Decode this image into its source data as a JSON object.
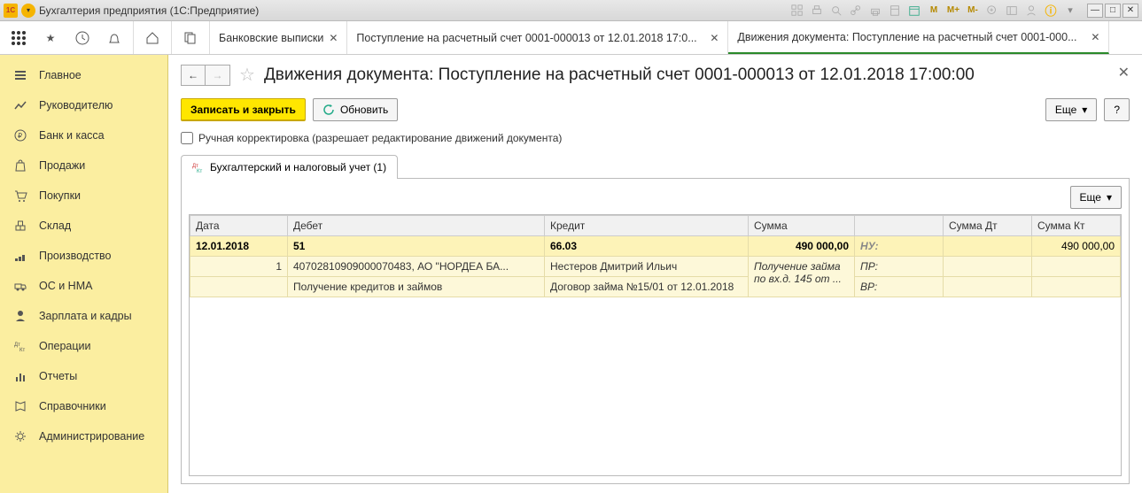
{
  "titlebar": {
    "logo_text": "1C",
    "title": "Бухгалтерия предприятия  (1С:Предприятие)",
    "m_labels": [
      "M",
      "M+",
      "M-"
    ]
  },
  "tabs": [
    {
      "label": "Банковские выписки",
      "closable": true,
      "active": false
    },
    {
      "label": "Поступление на расчетный счет 0001-000013 от 12.01.2018 17:0...",
      "closable": true,
      "active": false
    },
    {
      "label": "Движения документа: Поступление на расчетный счет 0001-000...",
      "closable": true,
      "active": true
    }
  ],
  "sidebar": {
    "items": [
      {
        "label": "Главное",
        "icon": "menu"
      },
      {
        "label": "Руководителю",
        "icon": "chart"
      },
      {
        "label": "Банк и касса",
        "icon": "ruble"
      },
      {
        "label": "Продажи",
        "icon": "bag"
      },
      {
        "label": "Покупки",
        "icon": "cart"
      },
      {
        "label": "Склад",
        "icon": "boxes"
      },
      {
        "label": "Производство",
        "icon": "factory"
      },
      {
        "label": "ОС и НМА",
        "icon": "truck"
      },
      {
        "label": "Зарплата и кадры",
        "icon": "person"
      },
      {
        "label": "Операции",
        "icon": "dtkt"
      },
      {
        "label": "Отчеты",
        "icon": "barchart"
      },
      {
        "label": "Справочники",
        "icon": "book"
      },
      {
        "label": "Администрирование",
        "icon": "gear"
      }
    ]
  },
  "page": {
    "title": "Движения документа: Поступление на расчетный счет 0001-000013 от 12.01.2018 17:00:00",
    "save_close": "Записать и закрыть",
    "refresh": "Обновить",
    "more": "Еще",
    "help": "?",
    "manual_edit": "Ручная корректировка (разрешает редактирование движений документа)",
    "subtab": "Бухгалтерский и налоговый учет (1)",
    "more2": "Еще"
  },
  "table": {
    "headers": {
      "date": "Дата",
      "debit": "Дебет",
      "credit": "Кредит",
      "sum": "Сумма",
      "sum_dt": "Сумма Дт",
      "sum_kt": "Сумма Кт"
    },
    "row": {
      "date": "12.01.2018",
      "n": "1",
      "debit_acc": "51",
      "credit_acc": "66.03",
      "sum": "490 000,00",
      "label1": "НУ:",
      "sum_kt1": "490 000,00",
      "debit_sub1": "40702810909000070483, АО \"НОРДЕА БА...",
      "credit_sub1": "Нестеров Дмитрий Ильич",
      "comment": "Получение займа по вх.д. 145 от ...",
      "label2": "ПР:",
      "debit_sub2": "Получение кредитов и займов",
      "credit_sub2": "Договор займа №15/01 от 12.01.2018",
      "label3": "ВР:"
    }
  }
}
